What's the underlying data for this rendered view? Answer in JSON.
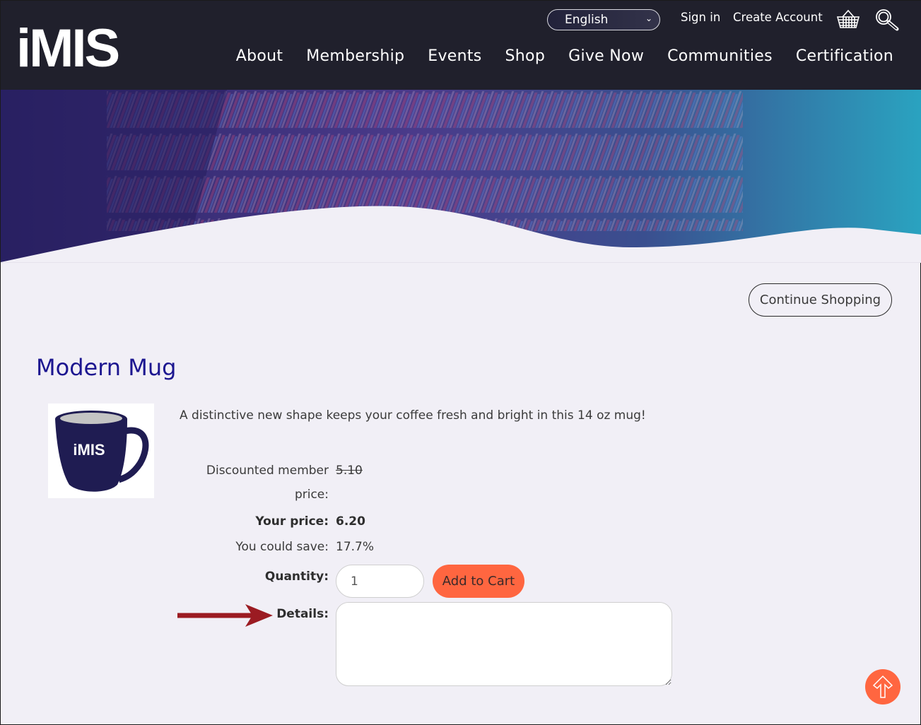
{
  "header": {
    "logo": "iMIS",
    "language": {
      "selected": "English"
    },
    "sign_in": "Sign in",
    "create_account": "Create Account",
    "icons": {
      "cart": "basket-icon",
      "search": "magnifier-icon"
    },
    "nav": [
      "About",
      "Membership",
      "Events",
      "Shop",
      "Give Now",
      "Communities",
      "Certification"
    ]
  },
  "continue_shopping": "Continue Shopping",
  "product": {
    "title": "Modern Mug",
    "image_text": "iMIS",
    "description": "A distinctive new shape keeps your coffee fresh and bright in this 14 oz mug!",
    "discount_label_line1": "Discounted member",
    "discount_label_line2": "price:",
    "discount_value": "5.10",
    "your_price_label": "Your price:",
    "your_price_value": "6.20",
    "save_label": "You could save:",
    "save_value": "17.7%",
    "quantity_label": "Quantity:",
    "quantity_value": "1",
    "add_to_cart": "Add to Cart",
    "details_label": "Details:",
    "details_value": ""
  },
  "colors": {
    "header_bg": "#20202c",
    "accent": "#ff6640",
    "title": "#1c1690",
    "page_bg": "#f1eff6",
    "annotation_arrow": "#9b1b22"
  }
}
